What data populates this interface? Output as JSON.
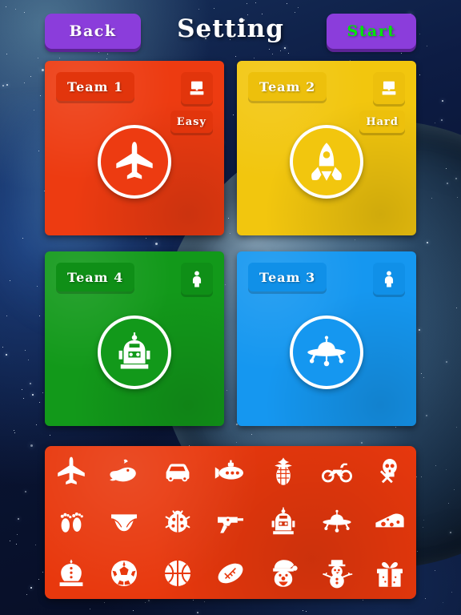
{
  "header": {
    "back_label": "Back",
    "title": "Setting",
    "start_label": "Start",
    "back_color": "#8b3ddb",
    "start_color": "#8b3ddb",
    "start_text_color": "#00e607",
    "title_color": "#ffffff"
  },
  "teams": [
    {
      "name": "Team 1",
      "color": "#ed3b11",
      "tag_color": "#e2350c",
      "controller_icon": "desktop-computer-icon",
      "difficulty": "Easy",
      "avatar_icon": "airplane-icon"
    },
    {
      "name": "Team 2",
      "color": "#f2c60e",
      "tag_color": "#edc00c",
      "controller_icon": "desktop-computer-icon",
      "difficulty": "Hard",
      "avatar_icon": "rocket-icon"
    },
    {
      "name": "Team 4",
      "color": "#12991a",
      "tag_color": "#0f8f17",
      "controller_icon": "person-icon",
      "difficulty": null,
      "avatar_icon": "robot-icon"
    },
    {
      "name": "Team 3",
      "color": "#1597f0",
      "tag_color": "#1090e8",
      "controller_icon": "person-icon",
      "difficulty": null,
      "avatar_icon": "ufo-icon"
    }
  ],
  "palette": {
    "background_color": "#e8380d",
    "icon_color": "#ffffff",
    "columns": 7,
    "rows": 3,
    "icons": [
      "airplane-icon",
      "whale-icon",
      "car-icon",
      "submarine-icon",
      "pineapple-icon",
      "motorcycle-icon",
      "skull-crossbones-icon",
      "footprints-icon",
      "underwear-icon",
      "ladybug-icon",
      "revolver-icon",
      "robot-icon",
      "ufo-icon",
      "cheese-icon",
      "crown-icon",
      "soccer-ball-icon",
      "basketball-icon",
      "football-icon",
      "santa-icon",
      "snowman-icon",
      "gift-icon"
    ]
  },
  "background": {
    "theme": "starfield-space",
    "planet": "earth-like-planet"
  }
}
